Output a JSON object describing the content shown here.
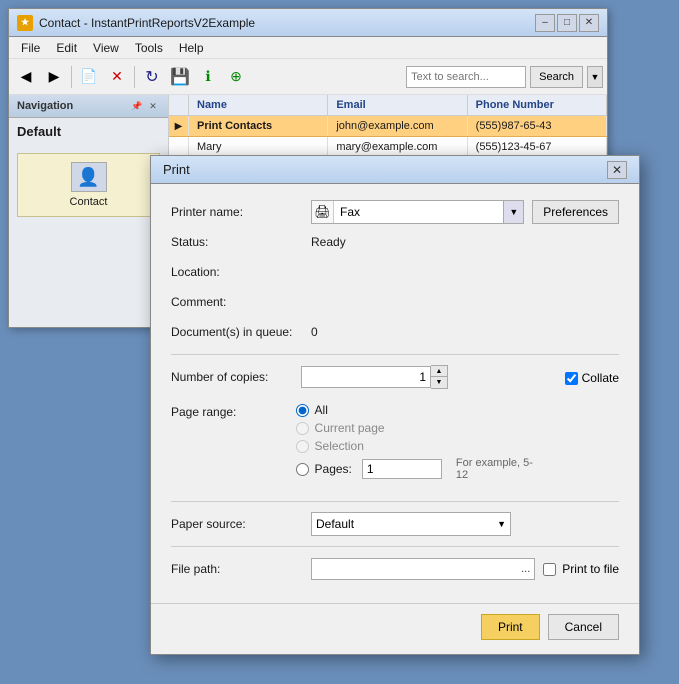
{
  "appWindow": {
    "title": "Contact - InstantPrintReportsV2Example",
    "icon": "★",
    "controls": {
      "minimize": "–",
      "maximize": "□",
      "close": "✕"
    }
  },
  "menuBar": {
    "items": [
      "File",
      "Edit",
      "View",
      "Tools",
      "Help"
    ]
  },
  "toolbar": {
    "searchPlaceholder": "Text to search...",
    "searchBtn": "Search"
  },
  "navigation": {
    "title": "Navigation",
    "defaultLabel": "Default",
    "item": "Contact"
  },
  "table": {
    "headers": [
      "",
      "Name",
      "Email",
      "Phone Number"
    ],
    "selectedRow": "Print Contacts",
    "rows": [
      {
        "indicator": "▶",
        "name": "Print Contacts",
        "email": "john@example.com",
        "phone": "(555)987-65-43"
      },
      {
        "indicator": "",
        "name": "Mary",
        "email": "mary@example.com",
        "phone": "(555)123-45-67"
      }
    ]
  },
  "printDialog": {
    "title": "Print",
    "closeBtn": "✕",
    "fields": {
      "printerName": {
        "label": "Printer name:",
        "icon": "🖨",
        "value": "Fax",
        "preferencesBtn": "Preferences"
      },
      "status": {
        "label": "Status:",
        "value": "Ready"
      },
      "location": {
        "label": "Location:",
        "value": ""
      },
      "comment": {
        "label": "Comment:",
        "value": ""
      },
      "documentsInQueue": {
        "label": "Document(s) in queue:",
        "value": "0"
      },
      "numberOfCopies": {
        "label": "Number of copies:",
        "value": "1"
      },
      "collate": {
        "label": "Collate",
        "checked": true
      },
      "pageRange": {
        "label": "Page range:",
        "options": [
          {
            "value": "all",
            "label": "All",
            "selected": true,
            "disabled": false
          },
          {
            "value": "current",
            "label": "Current page",
            "selected": false,
            "disabled": true
          },
          {
            "value": "selection",
            "label": "Selection",
            "selected": false,
            "disabled": true
          },
          {
            "value": "pages",
            "label": "Pages:",
            "selected": false,
            "disabled": false
          }
        ],
        "pagesValue": "1",
        "pagesHint": "For example, 5-12"
      },
      "paperSource": {
        "label": "Paper source:",
        "value": "Default"
      },
      "filePath": {
        "label": "File path:",
        "value": "",
        "dots": "...",
        "printToFileLabel": "Print to file",
        "printToFileChecked": false
      }
    },
    "footer": {
      "printBtn": "Print",
      "cancelBtn": "Cancel"
    }
  }
}
